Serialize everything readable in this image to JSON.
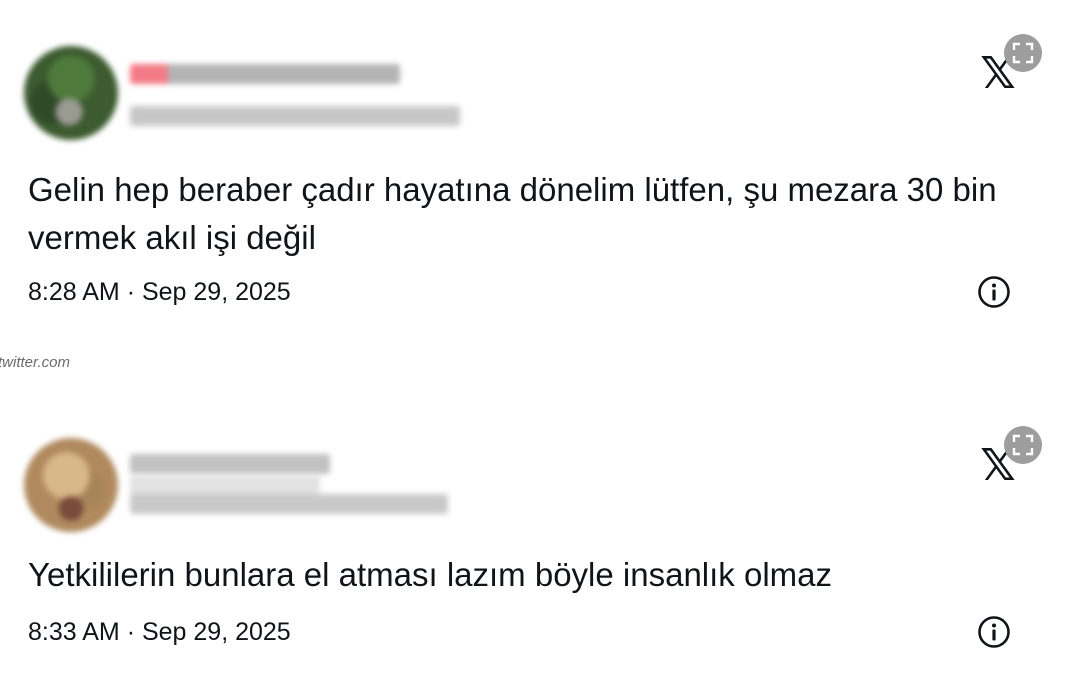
{
  "tweets": [
    {
      "text": "Gelin hep beraber çadır hayatına dönelim lütfen, şu mezara 30 bin vermek akıl işi değil",
      "time": "8:28 AM",
      "separator": "·",
      "date": "Sep 29, 2025",
      "logo": "𝕏"
    },
    {
      "text": "Yetkililerin bunlara el atması lazım böyle insanlık olmaz",
      "time": "8:33 AM",
      "separator": "·",
      "date": "Sep 29, 2025",
      "logo": "𝕏"
    }
  ],
  "source_label": "twitter.com",
  "icons": {
    "platform": "x-logo-icon",
    "expand": "expand-icon",
    "info": "info-icon"
  },
  "colors": {
    "text": "#0f1419",
    "expand_bg": "#9d9d9d",
    "source": "#6b6b6b"
  }
}
